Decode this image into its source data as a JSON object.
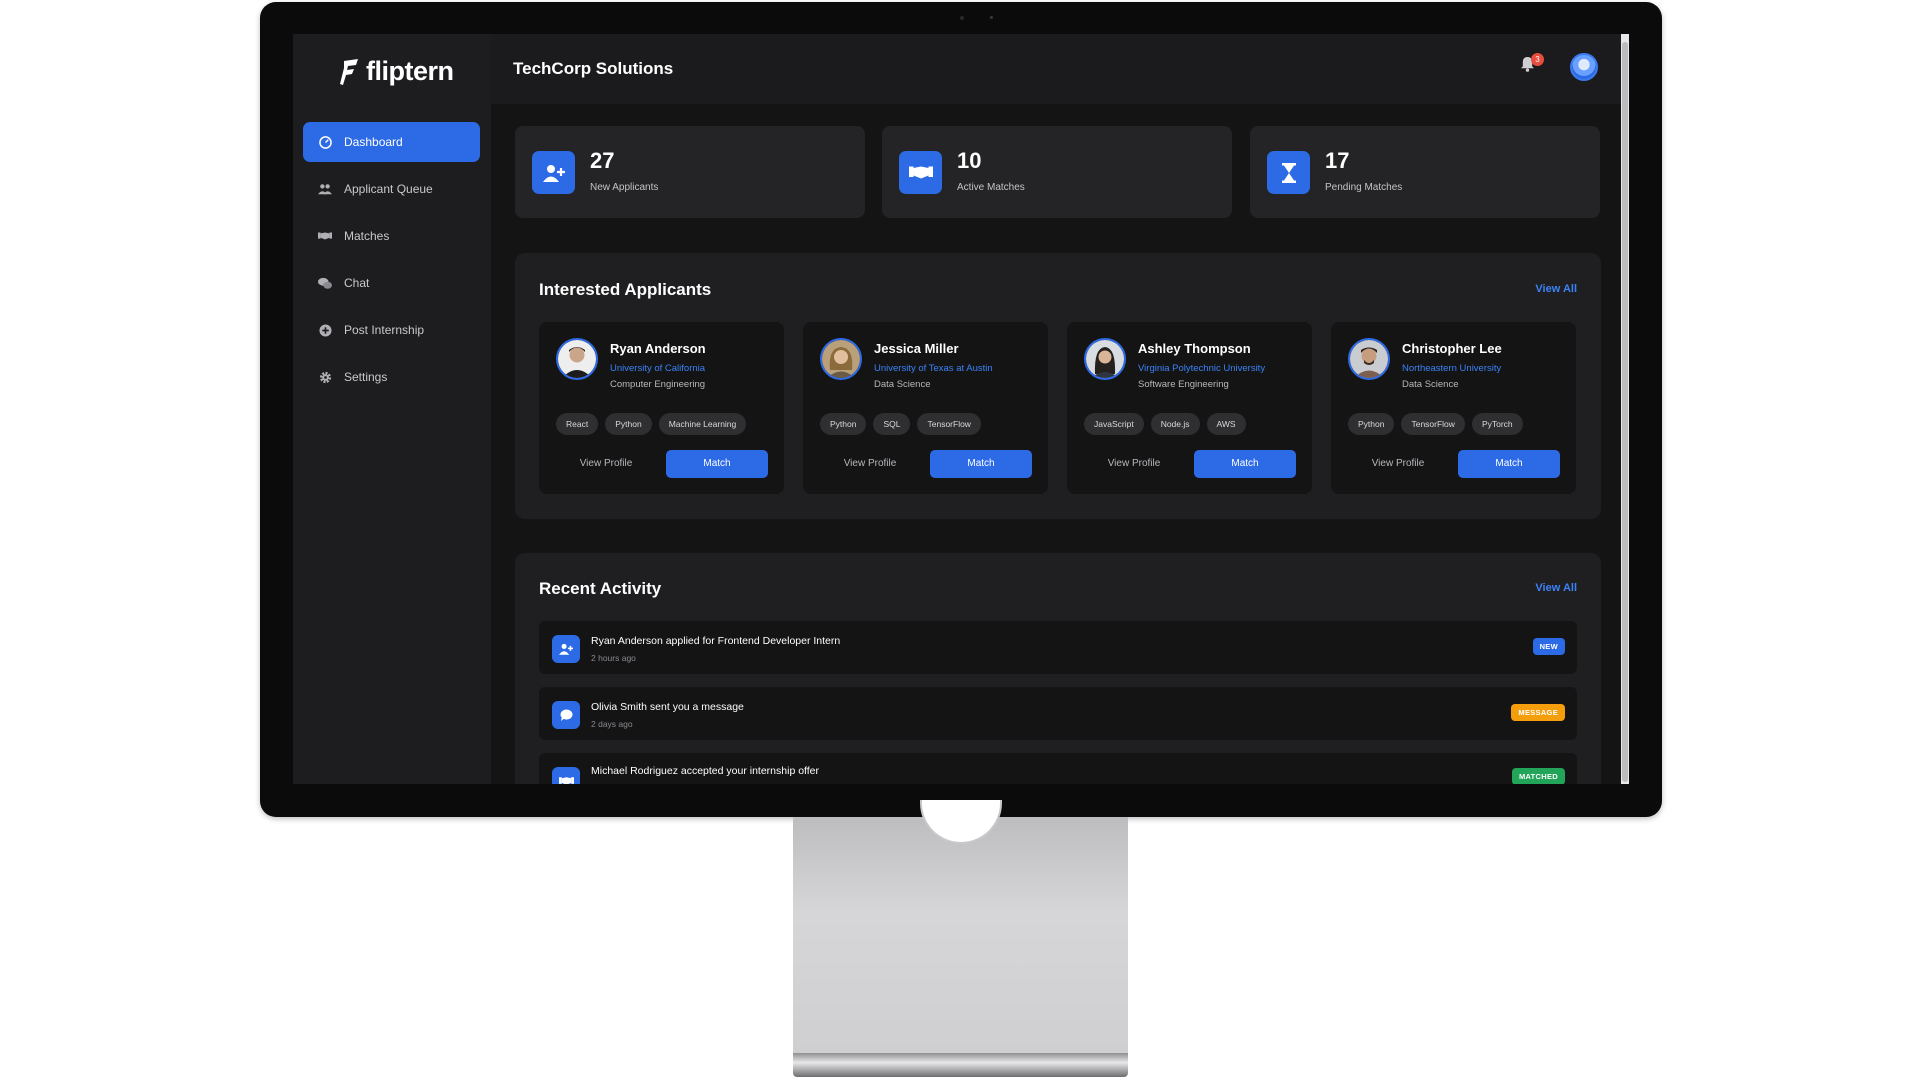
{
  "app": {
    "logo": "fliptern"
  },
  "sidebar": {
    "items": [
      {
        "label": "Dashboard",
        "icon": "dashboard-icon"
      },
      {
        "label": "Applicant Queue",
        "icon": "users-icon"
      },
      {
        "label": "Matches",
        "icon": "handshake-icon"
      },
      {
        "label": "Chat",
        "icon": "chat-icon"
      },
      {
        "label": "Post Internship",
        "icon": "plus-circle-icon"
      },
      {
        "label": "Settings",
        "icon": "gear-icon"
      }
    ]
  },
  "header": {
    "company": "TechCorp Solutions",
    "notifications": "3"
  },
  "stats": [
    {
      "value": "27",
      "label": "New Applicants",
      "icon": "user-plus-icon"
    },
    {
      "value": "10",
      "label": "Active Matches",
      "icon": "handshake-icon"
    },
    {
      "value": "17",
      "label": "Pending Matches",
      "icon": "hourglass-icon"
    }
  ],
  "interested": {
    "title": "Interested Applicants",
    "view_all": "View All",
    "view_profile": "View Profile",
    "match": "Match",
    "applicants": [
      {
        "name": "Ryan Anderson",
        "university": "University of California",
        "major": "Computer Engineering",
        "tags": [
          "React",
          "Python",
          "Machine Learning"
        ]
      },
      {
        "name": "Jessica Miller",
        "university": "University of Texas at Austin",
        "major": "Data Science",
        "tags": [
          "Python",
          "SQL",
          "TensorFlow"
        ]
      },
      {
        "name": "Ashley Thompson",
        "university": "Virginia Polytechnic University",
        "major": "Software Engineering",
        "tags": [
          "JavaScript",
          "Node.js",
          "AWS"
        ]
      },
      {
        "name": "Christopher Lee",
        "university": "Northeastern University",
        "major": "Data Science",
        "tags": [
          "Python",
          "TensorFlow",
          "PyTorch"
        ]
      }
    ]
  },
  "activity": {
    "title": "Recent Activity",
    "view_all": "View All",
    "items": [
      {
        "text": "Ryan Anderson applied for Frontend Developer Intern",
        "time": "2 hours ago",
        "badge": "NEW",
        "badge_color": "#2d6ae6",
        "icon": "user-plus-icon"
      },
      {
        "text": "Olivia Smith sent you a message",
        "time": "2 days ago",
        "badge": "MESSAGE",
        "badge_color": "#f59e0b",
        "icon": "chat-bubble-icon"
      },
      {
        "text": "Michael Rodriguez accepted your internship offer",
        "time": "",
        "badge": "MATCHED",
        "badge_color": "#22a559",
        "icon": "handshake-icon"
      }
    ]
  }
}
